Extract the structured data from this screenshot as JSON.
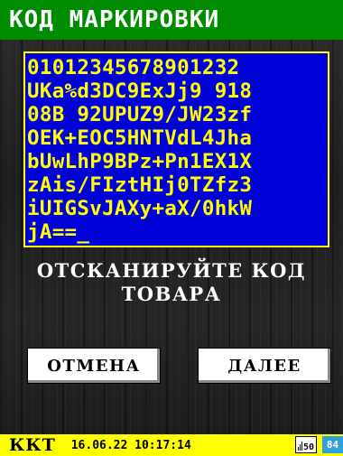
{
  "header": {
    "title": "КОД МАРКИРОВКИ"
  },
  "marking_code": {
    "lines": [
      "01012345678901232",
      "UKa%d3DC9ExJj9 918",
      "08B 92UPUZ9/JW23zf",
      "OEK+EOC5HNTVdL4Jha",
      "bUwLhP9BPz+Pn1EX1X",
      "zAis/FIztHIj0TZfz3",
      "iUIGSvJAXy+aX/0hkW",
      "jA==_"
    ]
  },
  "prompt": {
    "line1": "ОТСКАНИРУЙТЕ КОД",
    "line2": "ТОВАРА"
  },
  "buttons": {
    "cancel_label": "ОТМЕНА",
    "next_label": "ДАЛЕЕ"
  },
  "status_bar": {
    "device_label": "ККТ",
    "datetime": "16.06.22 10:17:14",
    "signal_value": "50",
    "battery_value": "84"
  },
  "colors": {
    "title_bg": "#008c00",
    "code_bg": "#0000d8",
    "code_text": "#ffff00",
    "status_bg": "#ffff00",
    "battery_bg": "#2fa0d8"
  }
}
